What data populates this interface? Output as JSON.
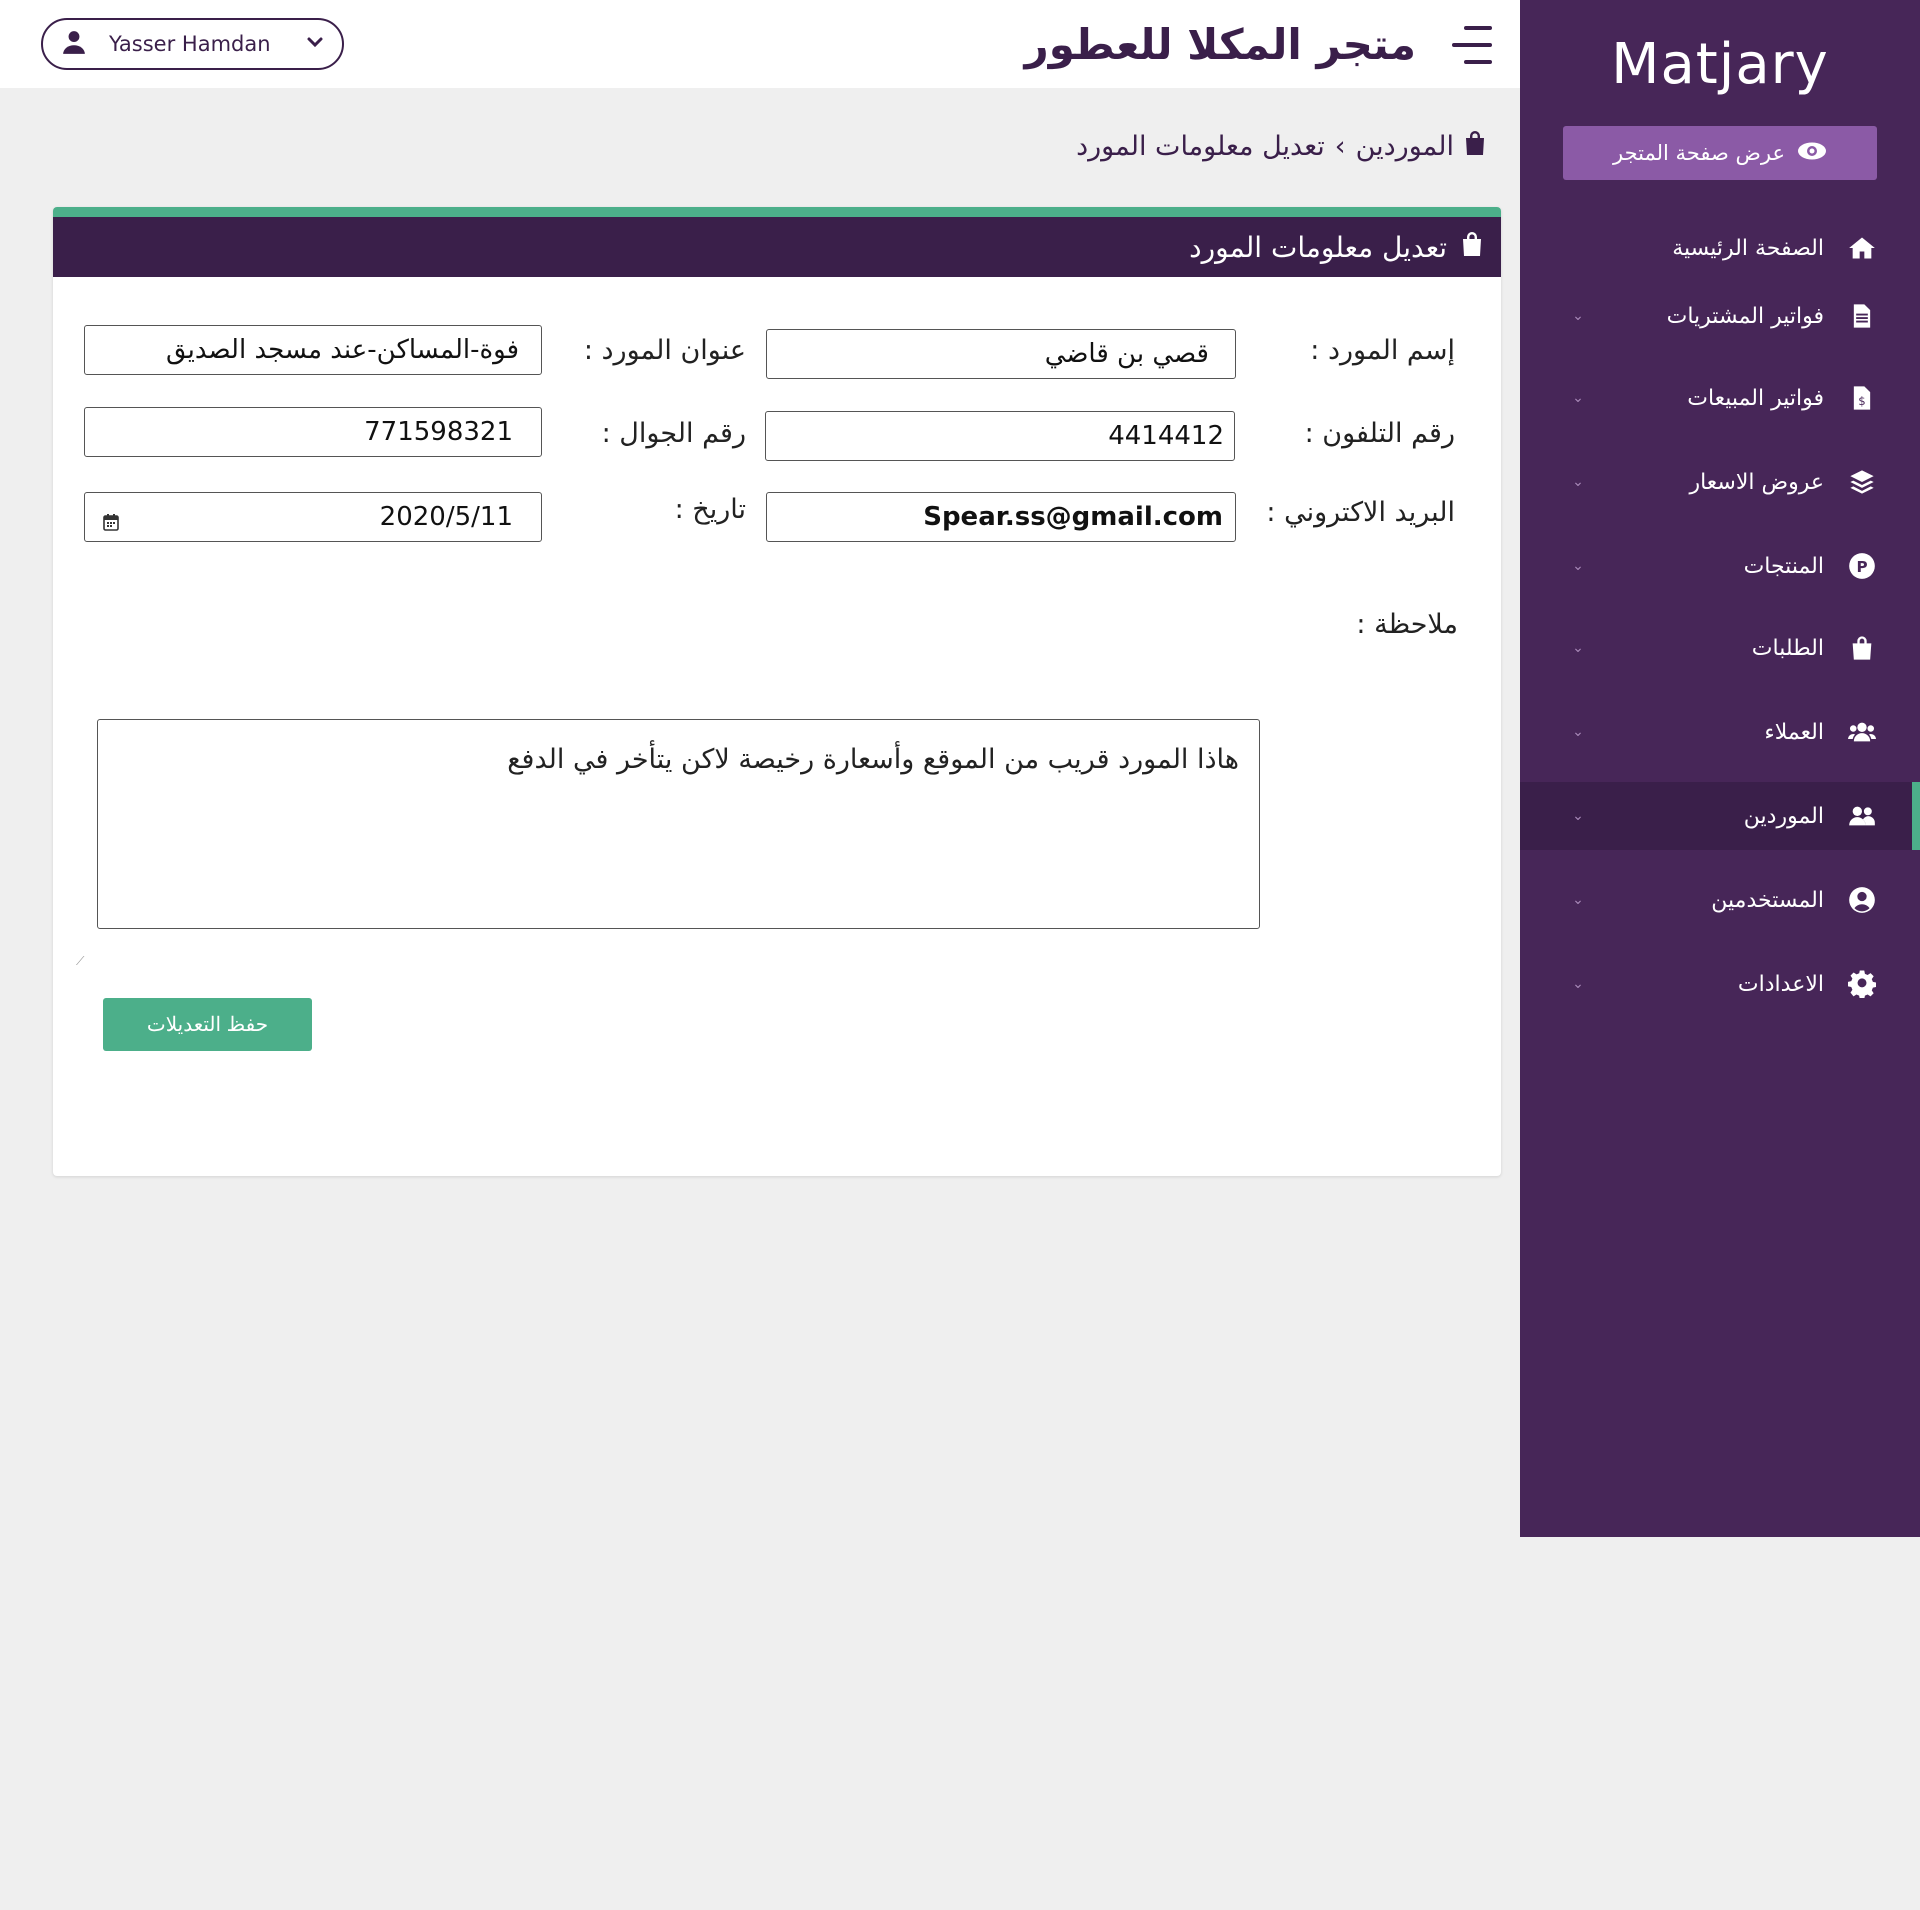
{
  "sidebar": {
    "brand": "Matjary",
    "view_store_label": "عرض صفحة المتجر",
    "items": [
      {
        "label": "الصفحة الرئيسية",
        "icon": "home-icon",
        "chevron": false,
        "active": false
      },
      {
        "label": "فواتير المشتريات",
        "icon": "file-icon",
        "chevron": true,
        "active": false
      },
      {
        "label": "فواتير المبيعات",
        "icon": "invoice-dollar-icon",
        "chevron": true,
        "active": false
      },
      {
        "label": "عروض الاسعار",
        "icon": "layers-icon",
        "chevron": true,
        "active": false
      },
      {
        "label": "المنتجات",
        "icon": "product-p-icon",
        "chevron": true,
        "active": false
      },
      {
        "label": "الطلبات",
        "icon": "shopping-bag-icon",
        "chevron": true,
        "active": false
      },
      {
        "label": "العملاء",
        "icon": "users-icon",
        "chevron": true,
        "active": false
      },
      {
        "label": "الموردين",
        "icon": "user-friends-icon",
        "chevron": true,
        "active": true
      },
      {
        "label": "المستخدمين",
        "icon": "user-circle-icon",
        "chevron": true,
        "active": false
      },
      {
        "label": "الاعدادات",
        "icon": "gear-icon",
        "chevron": true,
        "active": false
      }
    ]
  },
  "header": {
    "store_title": "متجر المكلا للعطور",
    "user_name": "Yasser Hamdan"
  },
  "breadcrumb": {
    "section": "الموردين",
    "separator": "›",
    "current": "تعديل معلومات المورد"
  },
  "form": {
    "title": "تعديل معلومات المورد",
    "supplier_name_label": "إسم المورد :",
    "supplier_name_value": "قصي بن قاضي",
    "supplier_address_label": "عنوان المورد :",
    "supplier_address_value": "فوة-المساكن-عند مسجد الصديق",
    "phone_label": "رقم التلفون  :",
    "phone_value": "4414412",
    "mobile_label": "رقم الجوال :",
    "mobile_value": "771598321",
    "email_label": "البريد الاكتروني :",
    "email_value": "Spear.ss@gmail.com",
    "date_label": "تاريخ :",
    "date_value": "2020/5/11",
    "note_label": "ملاحظة  :",
    "note_value": "هاذا المورد قريب من الموقع  وأسعارة رخيصة لاكن يتأخر في الدفع",
    "save_label": "حفظ التعديلات"
  },
  "colors": {
    "sidebar_bg": "#472658",
    "header_dark": "#3a1f4a",
    "accent_green": "#4caf8a",
    "view_store_btn": "#8b5aa6"
  }
}
